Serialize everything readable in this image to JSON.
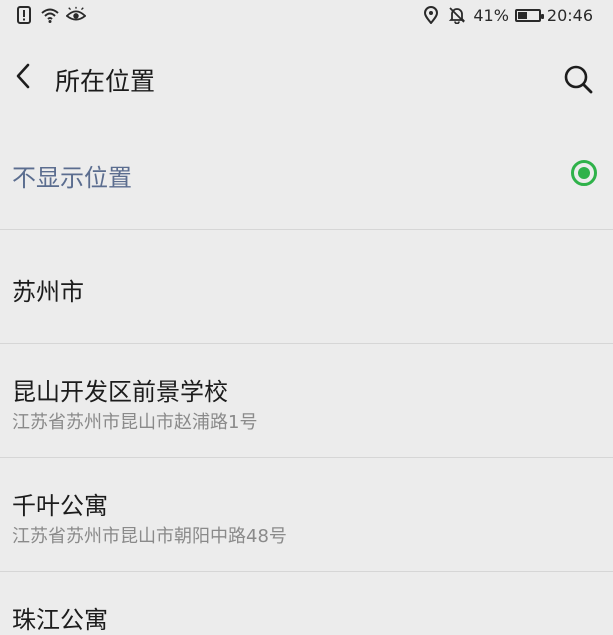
{
  "status_bar": {
    "left_icons": [
      "sim-alert-icon",
      "wifi-icon",
      "eye-icon"
    ],
    "right_icons": [
      "location-pin-icon",
      "bell-off-icon"
    ],
    "battery_percent": "41%",
    "battery_level": 0.41,
    "time": "20:46"
  },
  "header": {
    "title": "所在位置",
    "back_icon": "chevron-left-icon",
    "search_icon": "search-icon"
  },
  "locations": [
    {
      "name": "不显示位置",
      "address": "",
      "selected": true
    },
    {
      "name": "苏州市",
      "address": ""
    },
    {
      "name": "昆山开发区前景学校",
      "address": "江苏省苏州市昆山市赵浦路1号"
    },
    {
      "name": "千叶公寓",
      "address": "江苏省苏州市昆山市朝阳中路48号"
    },
    {
      "name": "珠江公寓",
      "address": ""
    }
  ],
  "colors": {
    "background": "#ececec",
    "selected_text": "#5b6d8f",
    "radio_green": "#2fb24a",
    "divider": "#d6d6d6"
  }
}
